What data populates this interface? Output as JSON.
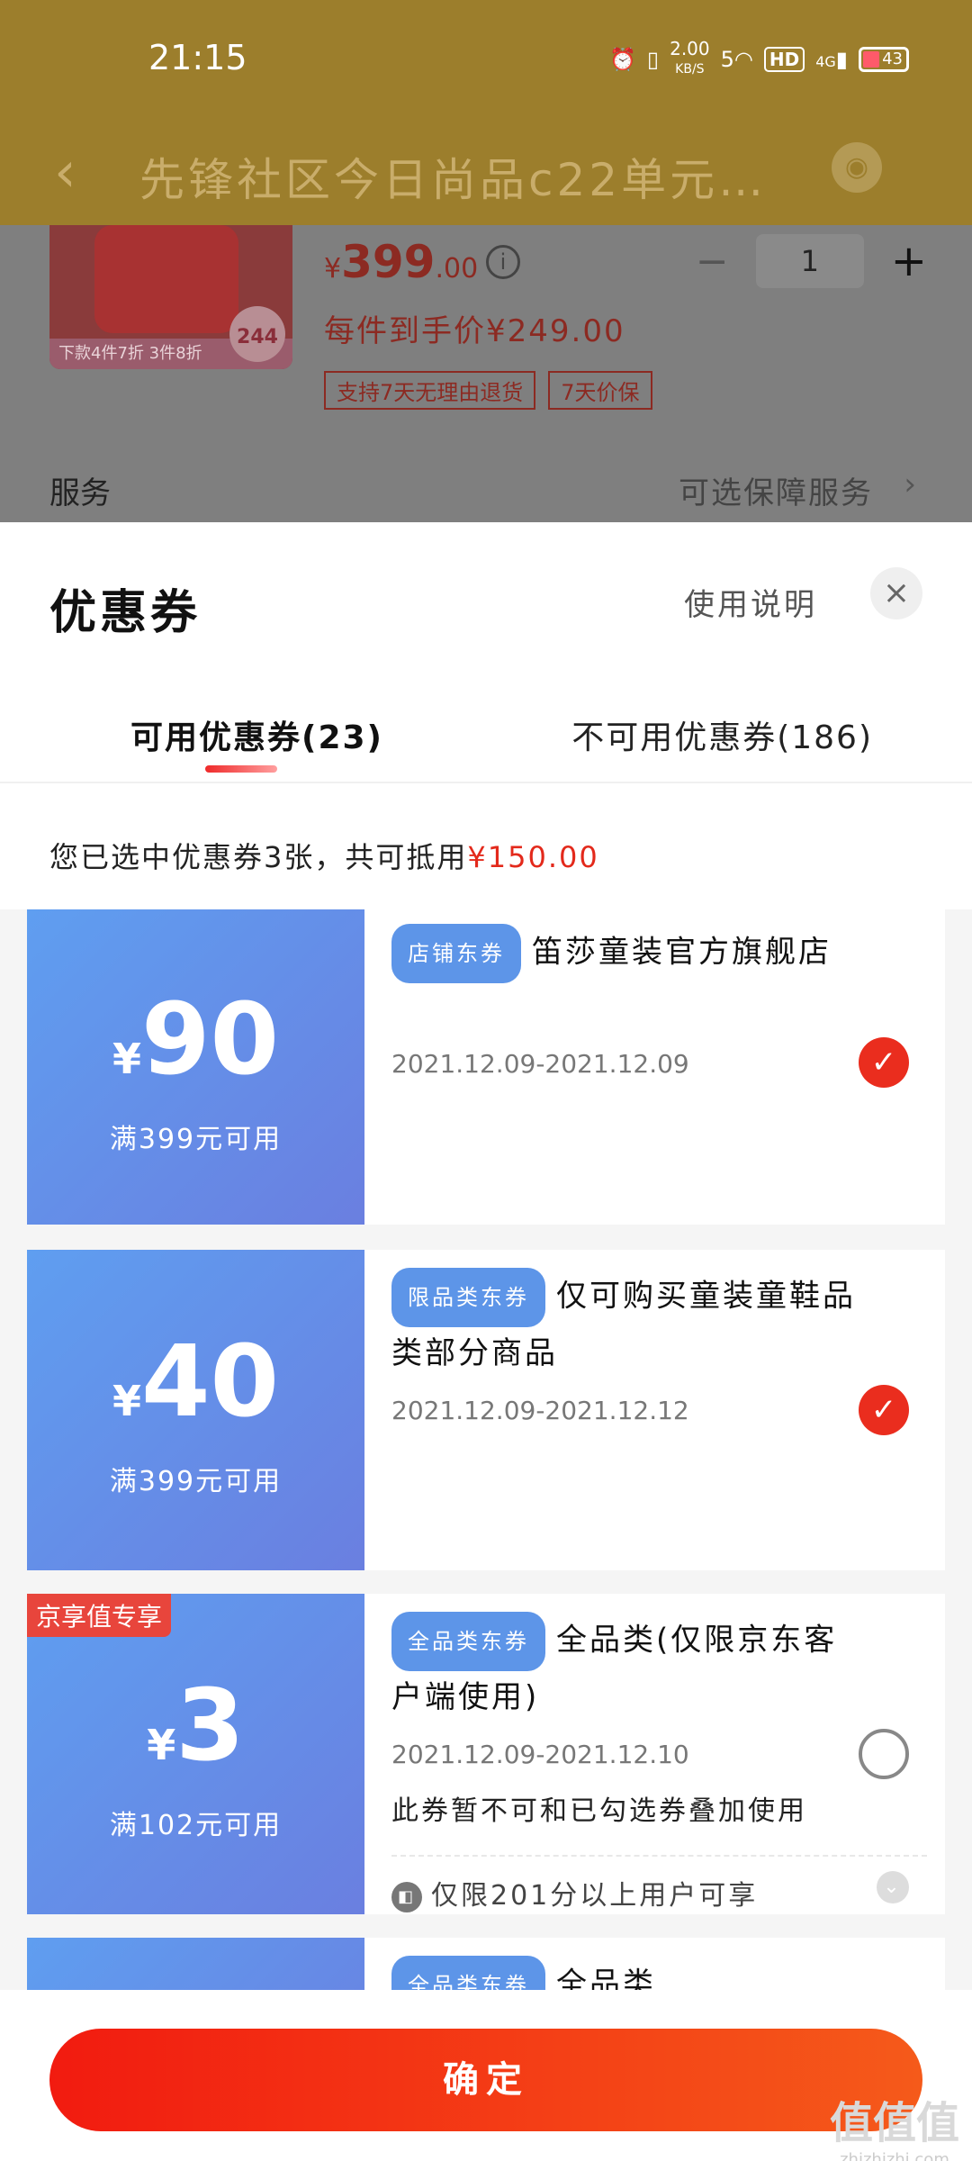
{
  "status_bar": {
    "time": "21:15",
    "net_speed": "2.00",
    "net_speed_unit": "KB/S",
    "wifi": "5",
    "hd": "HD",
    "cell": "4G",
    "battery": "43"
  },
  "nav": {
    "back_icon": "‹",
    "title": "先锋社区今日尚品c22单元...",
    "location_icon": "location-icon"
  },
  "product": {
    "image_banner": "下款4件7折 3件8折",
    "image_tag": "244",
    "price_currency": "¥",
    "price_int": "399",
    "price_dec": ".00",
    "info_icon": "i",
    "qty_minus": "−",
    "qty_value": "1",
    "qty_plus": "+",
    "final_price": "每件到手价¥249.00",
    "tags": [
      "支持7天无理由退货",
      "7天价保"
    ],
    "service_label": "服务",
    "service_value": "可选保障服务"
  },
  "sheet": {
    "title": "优惠券",
    "usage_link": "使用说明",
    "close_icon": "×",
    "tab_available": "可用优惠券(23)",
    "tab_unavailable": "不可用优惠券(186)",
    "summary_prefix": "您已选中优惠券3张，共可抵用",
    "summary_amount": "¥150.00"
  },
  "coupons": [
    {
      "currency": "¥",
      "amount": "90",
      "condition": "满399元可用",
      "tag": "店铺东券",
      "desc": "笛莎童装官方旗舰店",
      "date": "2021.12.09-2021.12.09",
      "checked": true
    },
    {
      "currency": "¥",
      "amount": "40",
      "condition": "满399元可用",
      "tag": "限品类东券",
      "desc": "仅可购买童装童鞋品类部分商品",
      "date": "2021.12.09-2021.12.12",
      "checked": true
    },
    {
      "badge": "京享值专享",
      "currency": "¥",
      "amount": "3",
      "condition": "满102元可用",
      "tag": "全品类东券",
      "desc": "全品类(仅限京东客户端使用)",
      "date": "2021.12.09-2021.12.10",
      "note": "此券暂不可和已勾选券叠加使用",
      "limit": "仅限201分以上用户可享",
      "checked": false
    },
    {
      "tag": "全品类东券",
      "desc": "全品类"
    }
  ],
  "footer": {
    "confirm": "确定",
    "watermark": "值值值",
    "watermark_sub": "zhizhizhi.com"
  }
}
